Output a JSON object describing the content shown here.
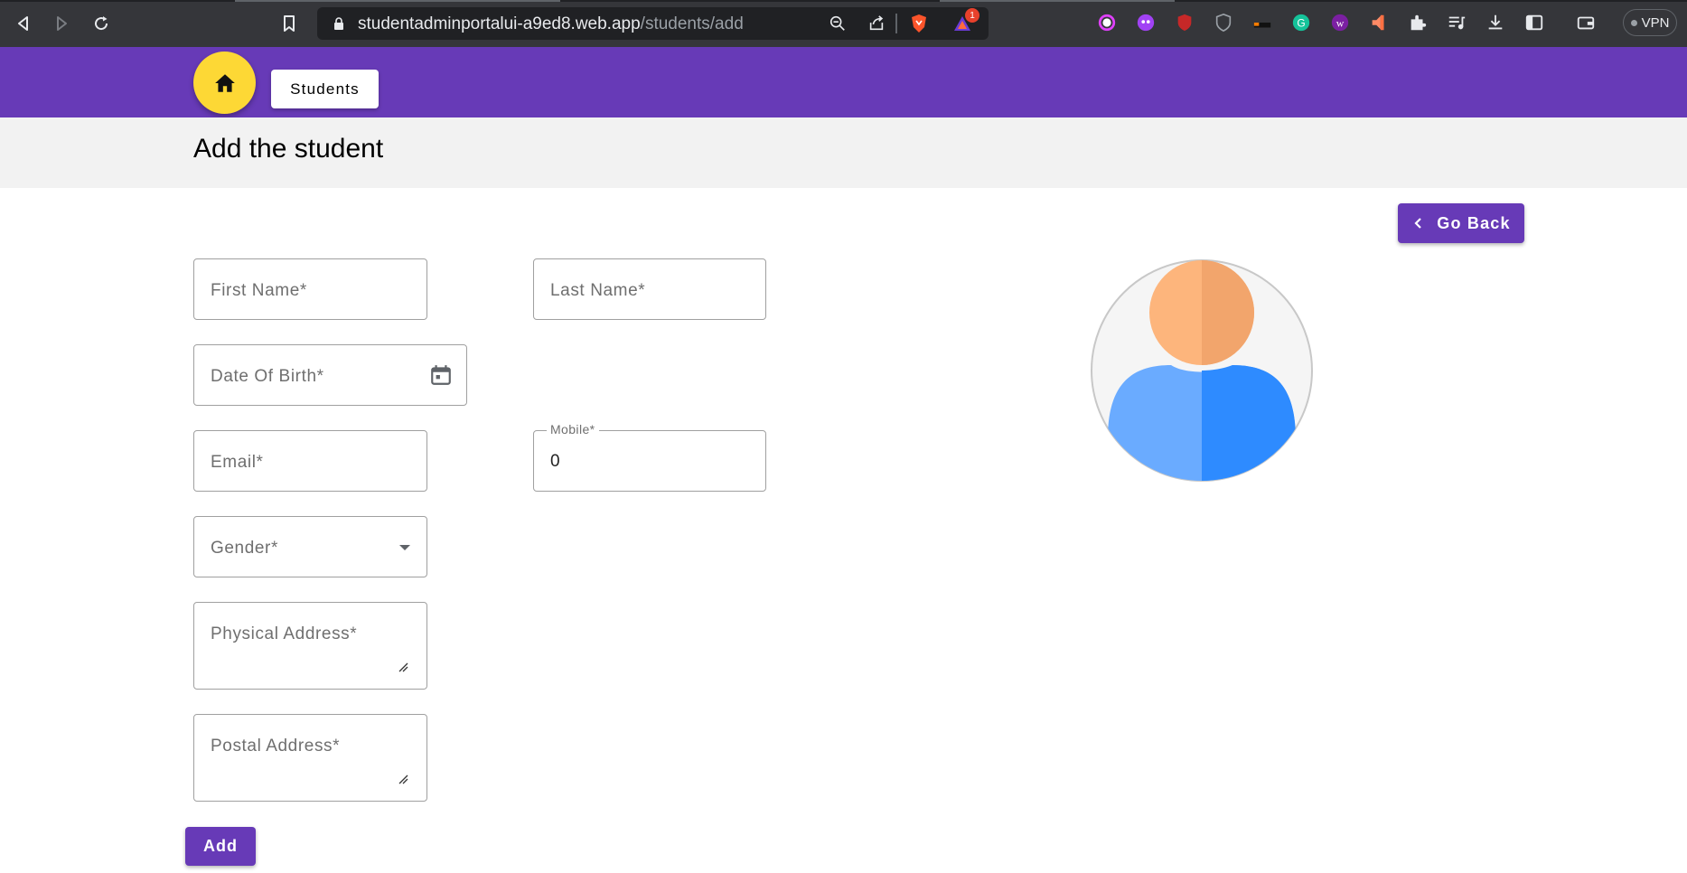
{
  "browser": {
    "url_host": "studentadminportalui-a9ed8.web.app",
    "url_path": "/students/add",
    "notification_count": "1",
    "vpn_label": "VPN"
  },
  "header": {
    "home_icon": "home-icon",
    "students_label": "Students"
  },
  "page": {
    "title": "Add the student",
    "go_back_label": "Go Back"
  },
  "form": {
    "first_name_placeholder": "First Name*",
    "last_name_placeholder": "Last Name*",
    "dob_placeholder": "Date Of Birth*",
    "email_placeholder": "Email*",
    "mobile_label": "Mobile*",
    "mobile_value": "0",
    "gender_placeholder": "Gender*",
    "physical_address_placeholder": "Physical Address*",
    "postal_address_placeholder": "Postal Address*",
    "add_label": "Add"
  },
  "colors": {
    "primary": "#673ab7",
    "accent": "#fdd835",
    "avatar_skin": "#fdb57c",
    "avatar_body": "#2e8bff"
  }
}
